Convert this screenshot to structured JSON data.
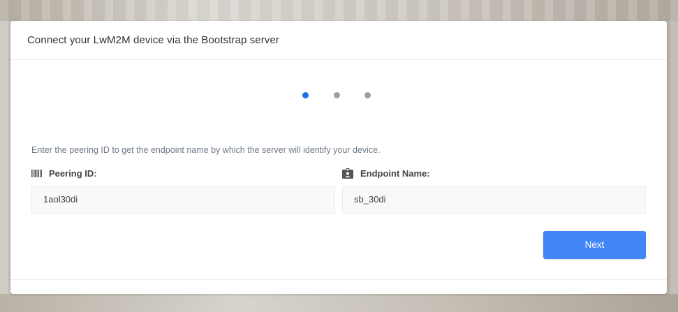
{
  "modal": {
    "title": "Connect your LwM2M device via the Bootstrap server"
  },
  "stepper": {
    "steps": [
      {
        "state": "active",
        "color": "#1a73e8"
      },
      {
        "state": "inactive",
        "color": "#9e9e9e"
      },
      {
        "state": "inactive",
        "color": "#9e9e9e"
      }
    ]
  },
  "form": {
    "description": "Enter the peering ID to get the endpoint name by which the server will identify your device.",
    "peering_id": {
      "label": "Peering ID:",
      "icon": "barcode-icon",
      "value": "1aol30di"
    },
    "endpoint_name": {
      "label": "Endpoint Name:",
      "icon": "id-badge-icon",
      "value": "sb_30di"
    }
  },
  "actions": {
    "next_label": "Next",
    "accent_color": "#4285f4"
  }
}
